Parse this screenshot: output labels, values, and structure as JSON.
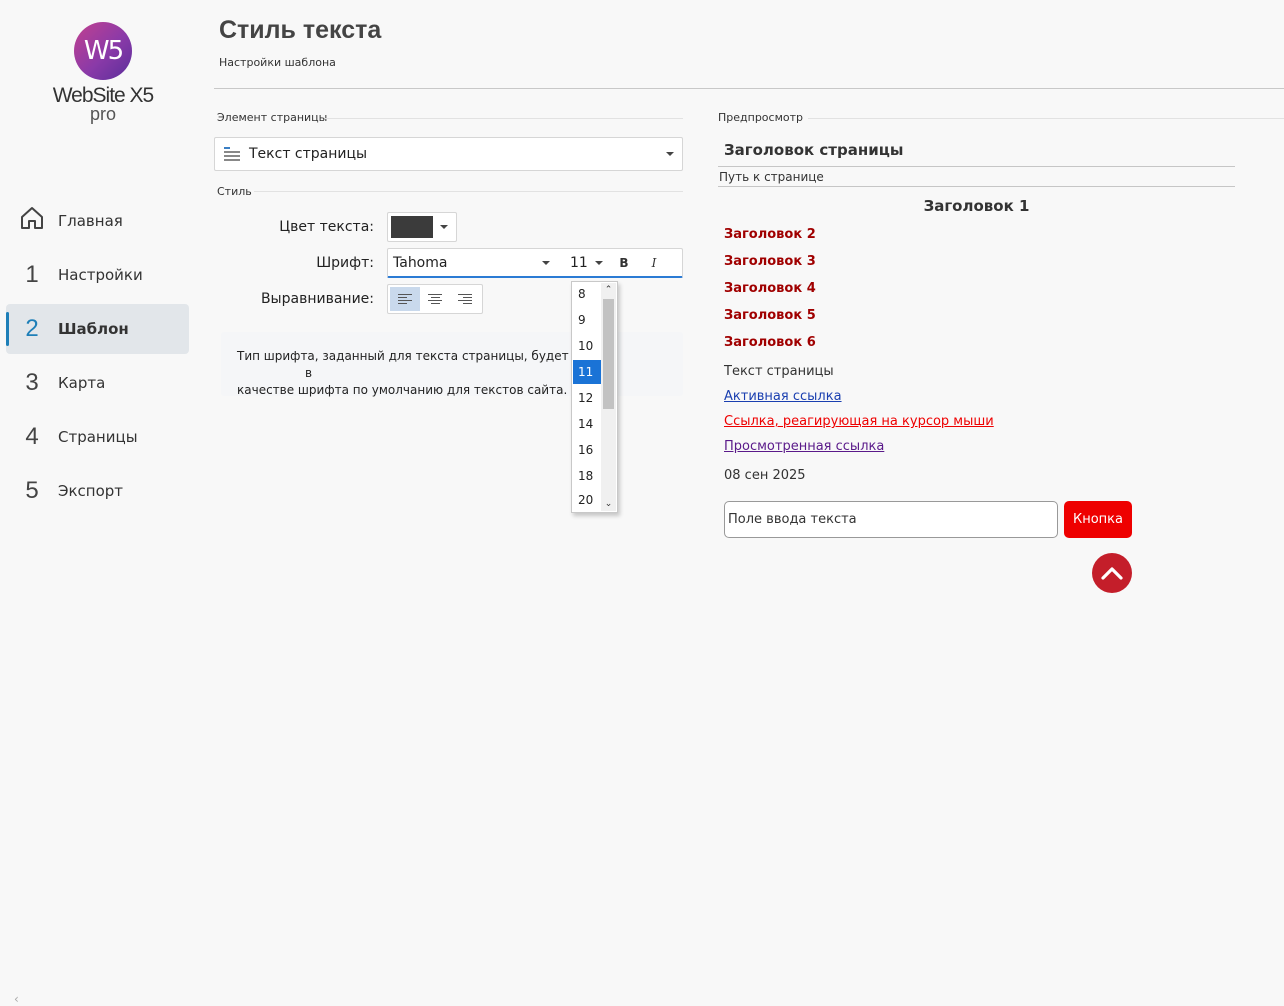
{
  "app": {
    "logo_mark": "W5",
    "logo_name": "WebSite X5",
    "logo_edition": "pro"
  },
  "sidebar": {
    "items": [
      {
        "num": "",
        "label": "Главная",
        "icon": "home-icon"
      },
      {
        "num": "1",
        "label": "Настройки"
      },
      {
        "num": "2",
        "label": "Шаблон",
        "active": true
      },
      {
        "num": "3",
        "label": "Карта"
      },
      {
        "num": "4",
        "label": "Страницы"
      },
      {
        "num": "5",
        "label": "Экспорт"
      }
    ],
    "collapse_icon": "chevron-left-icon"
  },
  "header": {
    "title": "Стиль текста",
    "subtitle": "Настройки шаблона"
  },
  "editor": {
    "element_label": "Элемент страницы",
    "element_value": "Текст страницы",
    "style_label": "Стиль",
    "color_label": "Цвет текста:",
    "color_value": "#3b3b3b",
    "font_label": "Шрифт:",
    "font_name": "Tahoma",
    "font_size": "11",
    "bold_label": "B",
    "italic_label": "I",
    "align_label": "Выравнивание:",
    "align_selected": "left",
    "info_text_1": "Тип шрифта, заданный для текста страницы, будет испо",
    "info_text_1b": "в",
    "info_text_2": "качестве шрифта по умолчанию для текстов сайта."
  },
  "size_dropdown": {
    "options": [
      "8",
      "9",
      "10",
      "11",
      "12",
      "14",
      "16",
      "18",
      "20"
    ],
    "selected": "11",
    "accent": "#1a73d6"
  },
  "preview": {
    "label": "Предпросмотр",
    "page_title": "Заголовок страницы",
    "path": "Путь к странице",
    "h1": "Заголовок 1",
    "h2": "Заголовок 2",
    "h3": "Заголовок 3",
    "h4": "Заголовок 4",
    "h5": "Заголовок 5",
    "h6": "Заголовок 6",
    "text": "Текст страницы",
    "link_active": "Активная ссылка",
    "link_hover": "Ссылка, реагирующая на курсор мыши",
    "link_visited": "Просмотренная ссылка",
    "date": "08 сен 2025",
    "input_value": "Поле ввода текста",
    "button_label": "Кнопка",
    "heading_color": "#a00000",
    "link_active_color": "#1a3fb0",
    "link_hover_color": "#ee0000",
    "link_visited_color": "#5a1a8a",
    "button_color": "#ee0000",
    "top_button_color": "#c41e2a",
    "top_icon": "chevron-up-icon"
  }
}
